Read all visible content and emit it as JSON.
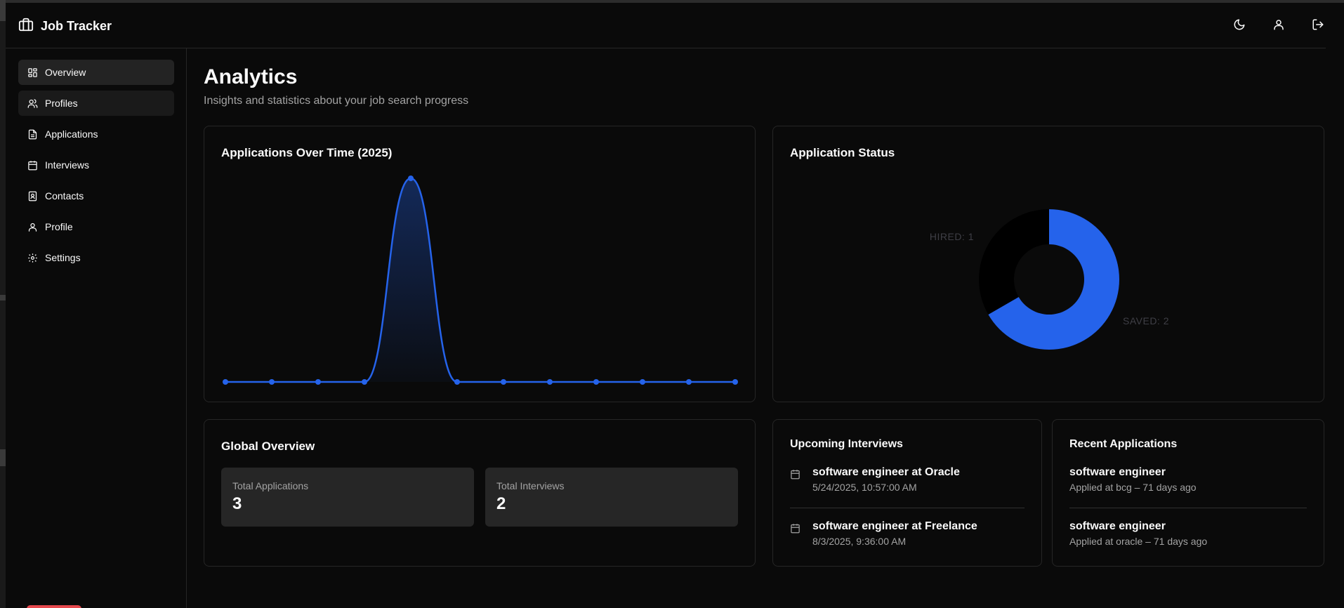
{
  "app": {
    "title": "Job Tracker"
  },
  "header": {
    "icons": [
      "theme-toggle-moon-icon",
      "user-icon",
      "logout-icon"
    ]
  },
  "sidebar": {
    "items": [
      {
        "label": "Overview",
        "icon": "grid-icon",
        "active": true
      },
      {
        "label": "Profiles",
        "icon": "users-icon",
        "hover": true
      },
      {
        "label": "Applications",
        "icon": "file-text-icon"
      },
      {
        "label": "Interviews",
        "icon": "calendar-icon"
      },
      {
        "label": "Contacts",
        "icon": "contact-book-icon"
      },
      {
        "label": "Profile",
        "icon": "user-icon"
      },
      {
        "label": "Settings",
        "icon": "gear-icon"
      }
    ]
  },
  "page": {
    "title": "Analytics",
    "subtitle": "Insights and statistics about your job search progress"
  },
  "colors": {
    "accent": "#2563eb",
    "background": "#0a0a0a",
    "card_border": "#262626",
    "muted_text": "#a3a3a3",
    "danger": "#e5484d"
  },
  "line_card": {
    "title": "Applications Over Time (2025)"
  },
  "donut_card": {
    "title": "Application Status"
  },
  "chart_data": [
    {
      "type": "area",
      "title": "Applications Over Time (2025)",
      "x": [
        1,
        2,
        3,
        4,
        5,
        6,
        7,
        8,
        9,
        10,
        11,
        12
      ],
      "series": [
        {
          "values": [
            0,
            0,
            0,
            0,
            3,
            0,
            0,
            0,
            0,
            0,
            0,
            0
          ]
        }
      ],
      "smooth": true,
      "grid": false,
      "ylim": [
        0,
        3
      ]
    },
    {
      "type": "pie",
      "title": "Application Status",
      "donut": true,
      "slices": [
        {
          "label": "SAVED",
          "value": 2,
          "color": "#2563eb"
        },
        {
          "label": "HIRED",
          "value": 1,
          "color": "#000000"
        }
      ],
      "label_format": "LABEL: VALUE"
    }
  ],
  "global_overview": {
    "title": "Global Overview",
    "stats": [
      {
        "label": "Total Applications",
        "value": "3"
      },
      {
        "label": "Total Interviews",
        "value": "2"
      }
    ]
  },
  "upcoming_interviews": {
    "title": "Upcoming Interviews",
    "items": [
      {
        "title": "software engineer at Oracle",
        "datetime": "5/24/2025, 10:57:00 AM"
      },
      {
        "title": "software engineer at Freelance",
        "datetime": "8/3/2025, 9:36:00 AM"
      }
    ]
  },
  "recent_applications": {
    "title": "Recent Applications",
    "items": [
      {
        "title": "software engineer",
        "subtitle": "Applied at bcg – 71 days ago"
      },
      {
        "title": "software engineer",
        "subtitle": "Applied at oracle – 71 days ago"
      }
    ]
  }
}
